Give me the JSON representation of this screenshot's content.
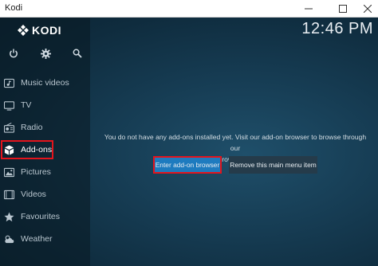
{
  "window": {
    "title": "Kodi"
  },
  "header": {
    "logo_text": "KODI",
    "clock": "12:46 PM"
  },
  "toolbar": {
    "icons": [
      "power-icon",
      "settings-gear-icon",
      "search-icon"
    ]
  },
  "sidebar": {
    "items": [
      {
        "label": "Music videos",
        "icon": "music-video-icon"
      },
      {
        "label": "TV",
        "icon": "tv-icon"
      },
      {
        "label": "Radio",
        "icon": "radio-icon"
      },
      {
        "label": "Add-ons",
        "icon": "addons-box-icon",
        "selected": true
      },
      {
        "label": "Pictures",
        "icon": "pictures-icon"
      },
      {
        "label": "Videos",
        "icon": "videos-icon"
      },
      {
        "label": "Favourites",
        "icon": "star-icon"
      },
      {
        "label": "Weather",
        "icon": "weather-icon"
      }
    ]
  },
  "main": {
    "message_line1": "You do not have any add-ons installed yet. Visit our add-on browser to browse through our",
    "message_line2": "collection and improve your Kodi experience.",
    "enter_button_label": "Enter add-on browser",
    "remove_button_label": "Remove this main menu item"
  },
  "colors": {
    "accent_blue": "#1d7bbf",
    "highlight_red": "#e4141c",
    "background": "#163c53"
  }
}
